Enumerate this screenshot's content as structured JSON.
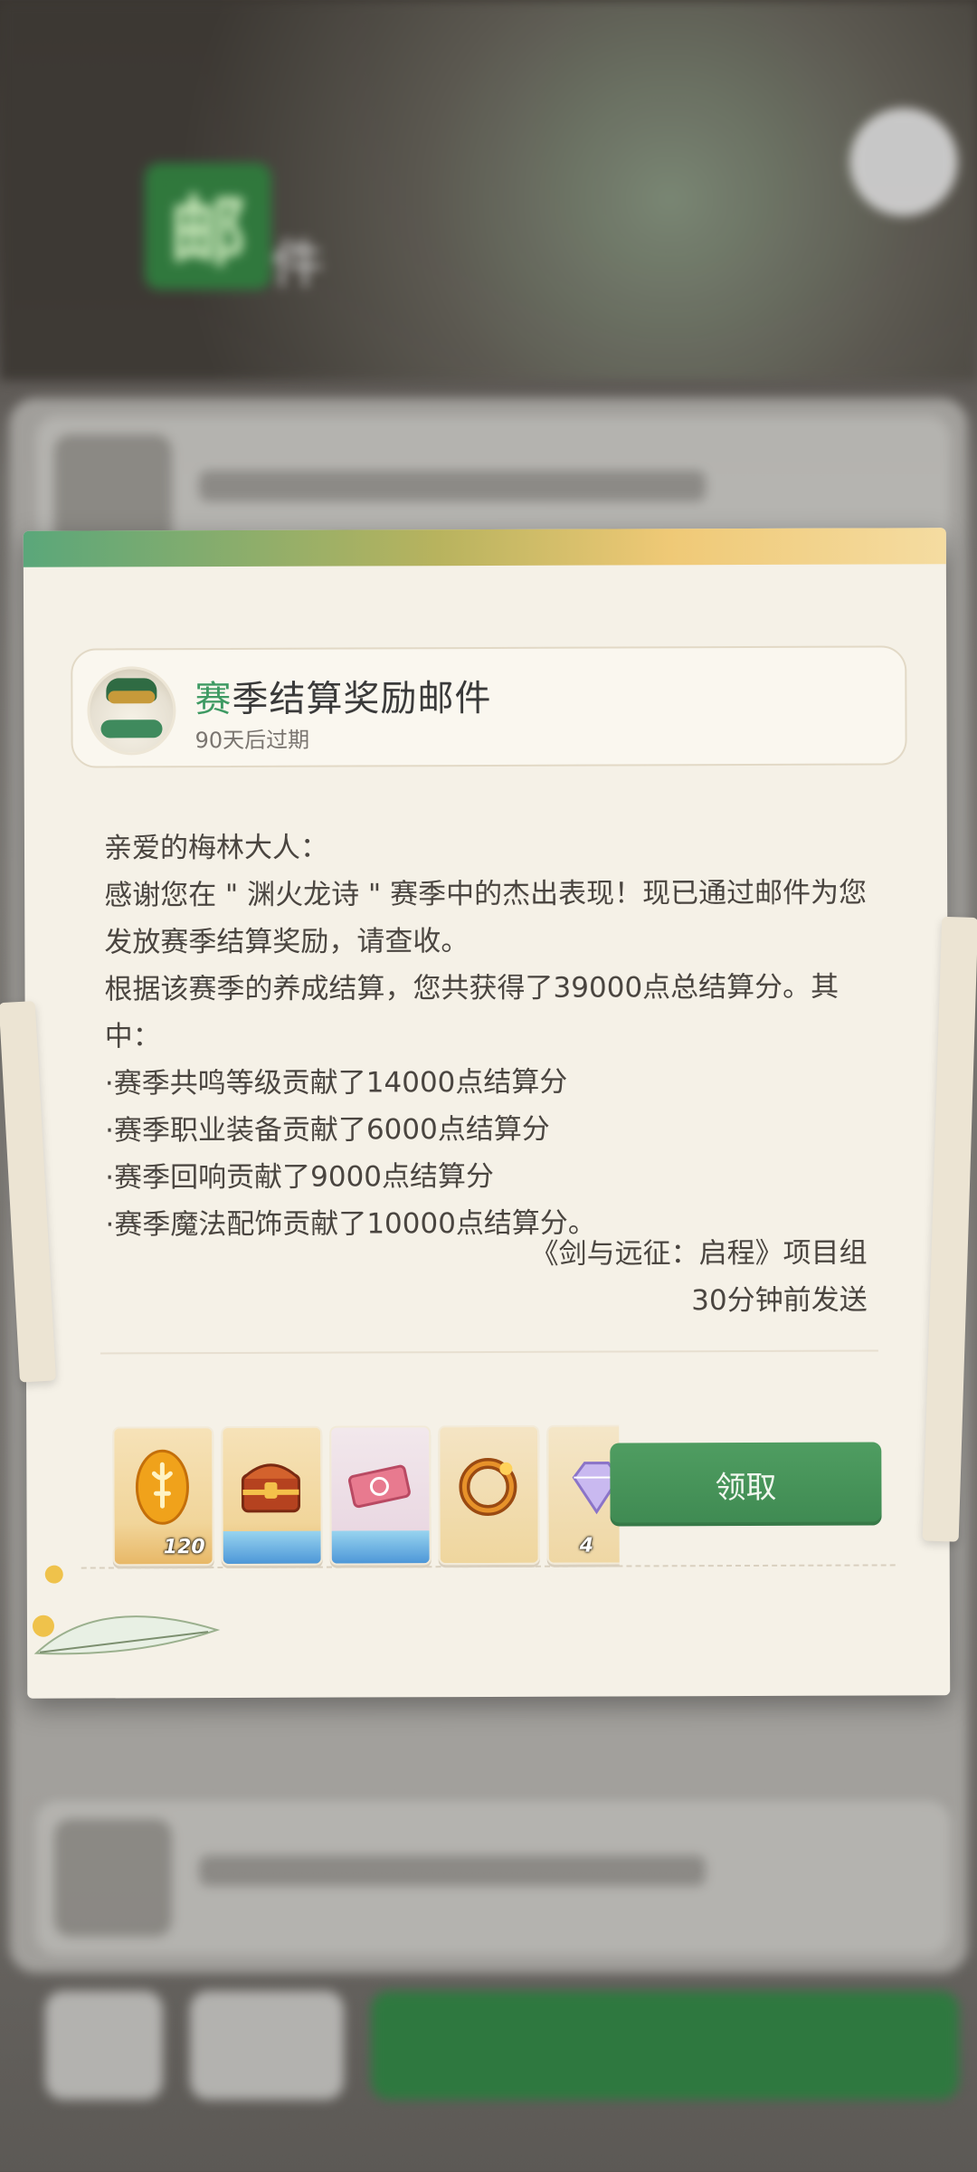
{
  "background": {
    "title_main": "邮",
    "title_sub": "件"
  },
  "mail": {
    "title_accent": "赛",
    "title_rest": "季结算奖励邮件",
    "expire": "90天后过期",
    "greeting": "亲爱的梅林大人：",
    "paragraph1": "感谢您在 \" 渊火龙诗 \" 赛季中的杰出表现！现已通过邮件为您发放赛季结算奖励，请查收。",
    "paragraph2": "根据该赛季的养成结算，您共获得了39000点总结算分。其中：",
    "bullets": [
      "·赛季共鸣等级贡献了14000点结算分",
      "·赛季职业装备贡献了6000点结算分",
      "·赛季回响贡献了9000点结算分",
      "·赛季魔法配饰贡献了10000点结算分。"
    ],
    "sender": "《剑与远征：启程》项目组",
    "sent_time": "30分钟前发送",
    "rewards": [
      {
        "icon": "amber-relic-icon",
        "count": "120"
      },
      {
        "icon": "treasure-chest-icon",
        "count": ""
      },
      {
        "icon": "ticket-icon",
        "count": ""
      },
      {
        "icon": "ring-icon",
        "count": ""
      },
      {
        "icon": "diamond-icon",
        "count": "4"
      }
    ],
    "claim_label": "领取"
  },
  "colors": {
    "accent_green": "#3e9a63",
    "claim_green": "#4f9d61",
    "paper": "#f5f1e7"
  }
}
